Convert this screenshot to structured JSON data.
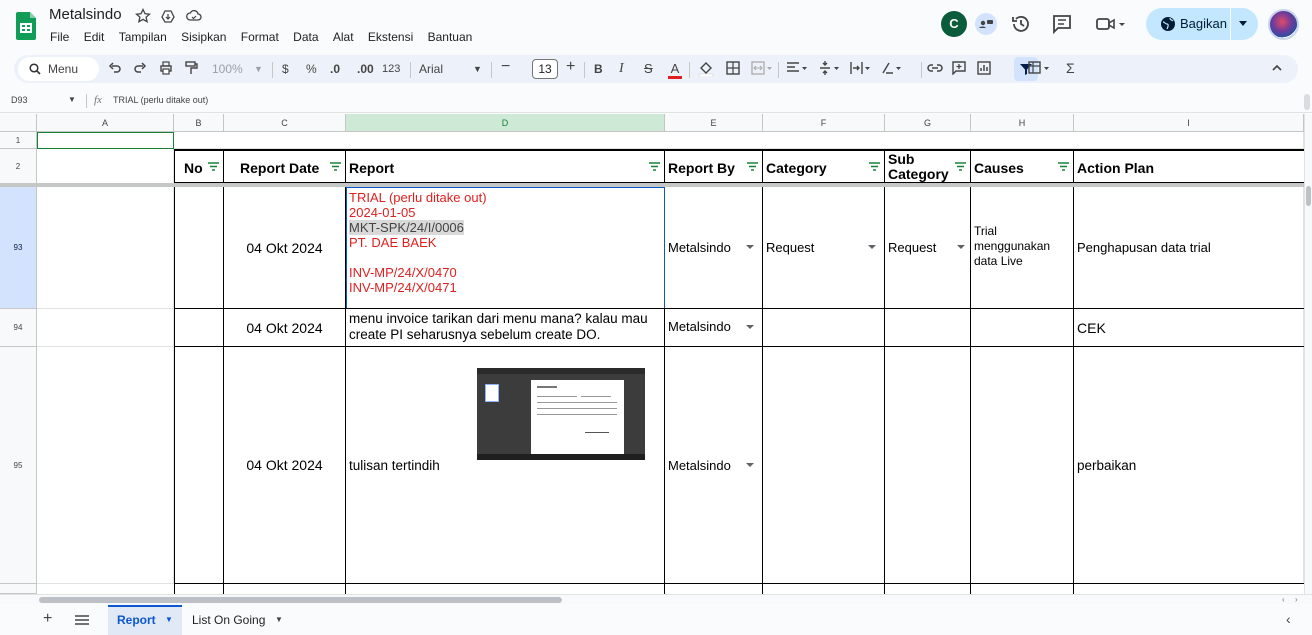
{
  "document": {
    "title": "Metalsindo"
  },
  "menu": [
    "File",
    "Edit",
    "Tampilan",
    "Sisipkan",
    "Format",
    "Data",
    "Alat",
    "Ekstensi",
    "Bantuan"
  ],
  "header": {
    "avatar_letter": "C",
    "share_label": "Bagikan"
  },
  "toolbar": {
    "search_label": "Menu",
    "zoom": "100%",
    "currency": "$",
    "percent": "%",
    "dec_less": ".0",
    "dec_more": ".00",
    "number_format": "123",
    "font": "Arial",
    "font_size": "13",
    "sigma": "Σ"
  },
  "formula_bar": {
    "cell_ref": "D93",
    "fx": "fx",
    "content": "TRIAL (perlu ditake out)"
  },
  "columns": [
    "A",
    "B",
    "C",
    "D",
    "E",
    "F",
    "G",
    "H",
    "I"
  ],
  "table": {
    "headers": {
      "no": "No",
      "report_date": "Report Date",
      "report": "Report",
      "report_by": "Report By",
      "category": "Category",
      "sub_category": "Sub Category",
      "causes": "Causes",
      "action_plan": "Action Plan"
    },
    "row_numbers": {
      "r1": "1",
      "r2": "2",
      "r93": "93",
      "r94": "94",
      "r95": "95"
    },
    "rows": [
      {
        "date": "04 Okt 2024",
        "report_lines": [
          "TRIAL (perlu ditake out)",
          "2024-01-05",
          "MKT-SPK/24/I/0006",
          "PT. DAE BAEK",
          "INV-MP/24/X/0470",
          "INV-MP/24/X/0471"
        ],
        "report_by": "Metalsindo",
        "category": "Request",
        "sub_category": "Request",
        "causes": "Trial menggunakan data Live",
        "action_plan": "Penghapusan data trial"
      },
      {
        "date": "04 Okt 2024",
        "report": "menu invoice tarikan dari menu mana? kalau mau create PI seharusnya sebelum create DO.",
        "report_by": "Metalsindo",
        "category": "",
        "sub_category": "",
        "causes": "",
        "action_plan": "CEK"
      },
      {
        "date": "04 Okt 2024",
        "report": "tulisan tertindih",
        "report_by": "Metalsindo",
        "category": "",
        "sub_category": "",
        "causes": "",
        "action_plan": "perbaikan"
      }
    ]
  },
  "sheets": [
    {
      "label": "Report",
      "active": true
    },
    {
      "label": "List On Going",
      "active": false
    }
  ],
  "colors": {
    "accent": "#0b57d0",
    "red_text": "#e02020",
    "share_bg": "#c2e7ff",
    "logo_green": "#0f9d58"
  }
}
